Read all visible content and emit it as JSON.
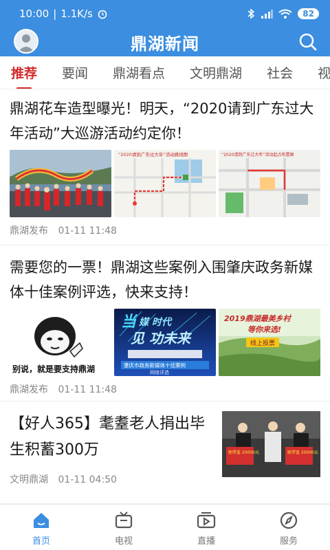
{
  "status": {
    "time": "10:00",
    "speed": "1.1K/s",
    "battery": "82"
  },
  "header": {
    "title": "鼎湖新闻"
  },
  "tabs": [
    "推荐",
    "要闻",
    "鼎湖看点",
    "文明鼎湖",
    "社会",
    "视频"
  ],
  "articles": [
    {
      "title": "鼎湖花车造型曝光！明天，“2020请到广东过大年活动”大巡游活动约定你！",
      "thumb2_caption": "“2020请到广东过大年”活动路线图",
      "thumb3_caption": "“2020请到广东过大年”活动起点布置图",
      "source": "鼎湖发布",
      "time": "01-11 11:48"
    },
    {
      "title": "需要您的一票！鼎湖这些案例入围肇庆政务新媒体十佳案例评选，快来支持！",
      "thumb1_caption": "别说，就是要支持鼎湖",
      "thumb2_line1": "肇庆市政务新媒体十佳案例",
      "thumb2_line2": "网络评选",
      "thumb3_title": "2019鼎湖最美乡村",
      "thumb3_sub": "等你来选!",
      "thumb3_badge": "线上投票",
      "source": "鼎湖发布",
      "time": "01-11 11:48"
    },
    {
      "title": "【好人365】耄耋老人捐出毕生积蓄300万",
      "sign1": "助学金 20000元",
      "sign2": "助学金 20000元",
      "source": "文明鼎湖",
      "time": "01-11 04:50"
    }
  ],
  "bottom_nav": [
    {
      "label": "首页",
      "icon": "home-icon",
      "active": true
    },
    {
      "label": "电视",
      "icon": "tv-icon",
      "active": false
    },
    {
      "label": "直播",
      "icon": "live-video-icon",
      "active": false
    },
    {
      "label": "服务",
      "icon": "compass-icon",
      "active": false
    }
  ],
  "colors": {
    "accent": "#3b8ee0",
    "active_tab": "#d42a2a"
  }
}
